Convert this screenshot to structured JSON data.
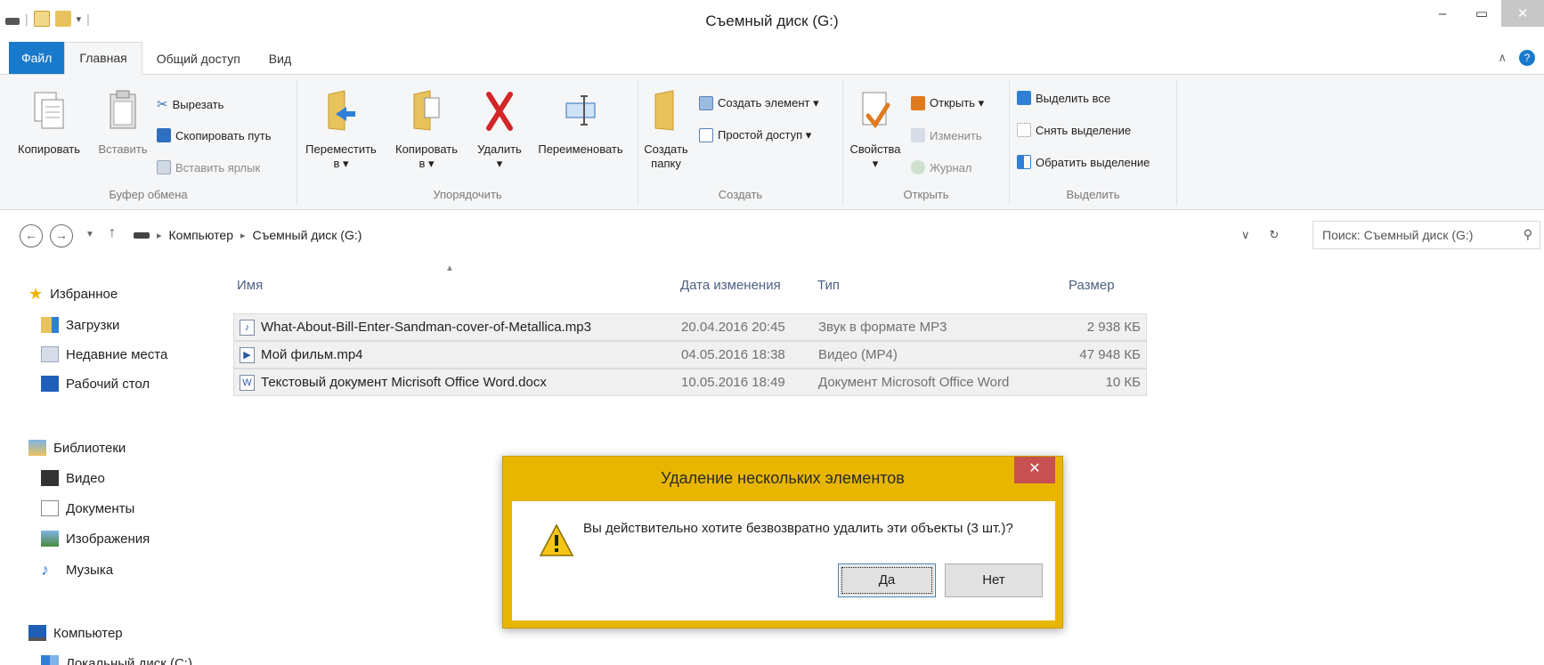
{
  "window": {
    "title": "Съемный диск (G:)"
  },
  "ribbon": {
    "tabs": [
      {
        "label": "Файл"
      },
      {
        "label": "Главная"
      },
      {
        "label": "Общий доступ"
      },
      {
        "label": "Вид"
      }
    ],
    "clipboard": {
      "label": "Буфер обмена",
      "copy": "Копировать",
      "paste": "Вставить",
      "cut": "Вырезать",
      "copy_path": "Скопировать путь",
      "paste_shortcut": "Вставить ярлык"
    },
    "organize": {
      "label": "Упорядочить",
      "move_to": "Переместить",
      "move_to_sub": "в ▾",
      "copy_to": "Копировать",
      "copy_to_sub": "в ▾",
      "delete": "Удалить",
      "delete_sub": "▾",
      "rename": "Переименовать"
    },
    "new": {
      "label": "Создать",
      "new_folder": "Создать",
      "new_folder_sub": "папку",
      "new_item": "Создать элемент ▾",
      "easy_access": "Простой доступ ▾"
    },
    "open": {
      "label": "Открыть",
      "properties": "Свойства",
      "properties_sub": "▾",
      "open": "Открыть ▾",
      "edit": "Изменить",
      "history": "Журнал"
    },
    "select": {
      "label": "Выделить",
      "select_all": "Выделить все",
      "select_none": "Снять выделение",
      "invert": "Обратить выделение"
    }
  },
  "address": {
    "crumbs": [
      "Компьютер",
      "Съемный диск (G:)"
    ],
    "search_placeholder": "Поиск: Съемный диск (G:)"
  },
  "nav": {
    "favorites": "Избранное",
    "downloads": "Загрузки",
    "recent": "Недавние места",
    "desktop": "Рабочий стол",
    "libraries": "Библиотеки",
    "video": "Видео",
    "documents": "Документы",
    "pictures": "Изображения",
    "music": "Музыка",
    "computer": "Компьютер",
    "local_disk": "Локальный диск (C:)"
  },
  "files": {
    "columns": [
      "Имя",
      "Дата изменения",
      "Тип",
      "Размер"
    ],
    "rows": [
      {
        "name": "What-About-Bill-Enter-Sandman-cover-of-Metallica.mp3",
        "date": "20.04.2016 20:45",
        "type": "Звук в формате MP3",
        "size": "2 938 КБ"
      },
      {
        "name": "Мой фильм.mp4",
        "date": "04.05.2016 18:38",
        "type": "Видео (MP4)",
        "size": "47 948 КБ"
      },
      {
        "name": "Текстовый документ Micrisoft Office Word.docx",
        "date": "10.05.2016 18:49",
        "type": "Документ Microsoft Office Word",
        "size": "10 КБ"
      }
    ]
  },
  "dialog": {
    "title": "Удаление нескольких элементов",
    "message": "Вы действительно хотите безвозвратно удалить эти объекты (3 шт.)?",
    "yes": "Да",
    "no": "Нет"
  },
  "colors": {
    "accent": "#1979ca",
    "dialog_frame": "#e8b600",
    "dialog_close": "#c75050"
  }
}
